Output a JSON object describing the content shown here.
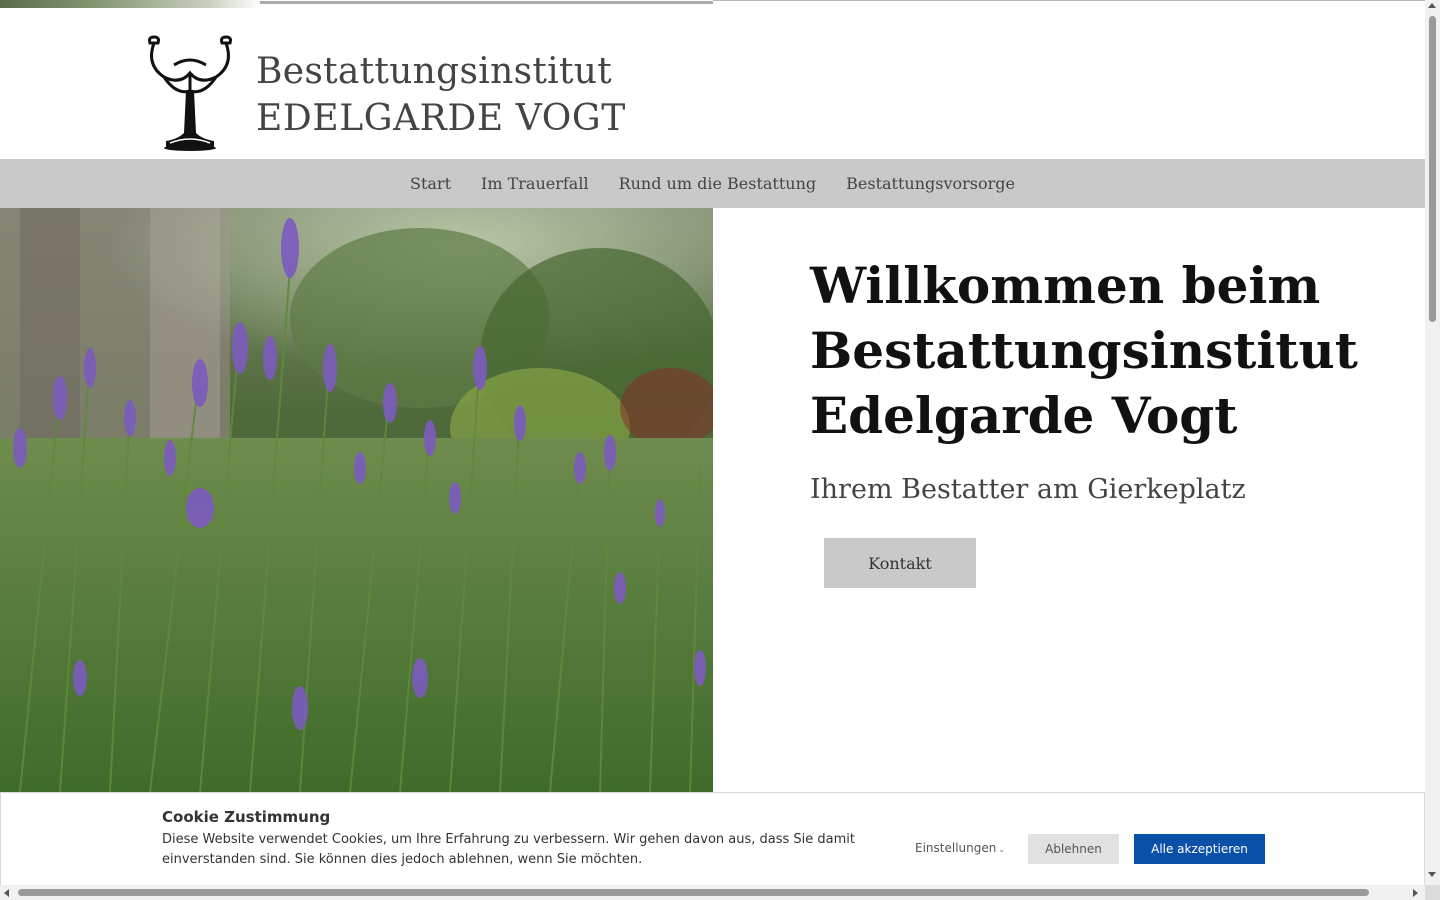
{
  "header": {
    "brand_line1": "Bestattungsinstitut",
    "brand_line2": "EDELGARDE VOGT",
    "logo_icon": "candelabra-logo-icon"
  },
  "nav": {
    "items": [
      {
        "label": "Start"
      },
      {
        "label": "Im Trauerfall"
      },
      {
        "label": "Rund um die Bestattung"
      },
      {
        "label": "Bestattungsvorsorge"
      }
    ]
  },
  "hero": {
    "title": "Willkommen beim Bestattungsinstitut Edelgarde Vogt",
    "subtitle": "Ihrem Bestatter am Gierkeplatz",
    "button_label": "Kontakt",
    "image_subject": "lavender-field-photo"
  },
  "cookie": {
    "title": "Cookie Zustimmung",
    "text": "Diese Website verwendet Cookies, um Ihre Erfahrung zu verbessern. Wir gehen davon aus, dass Sie damit einverstanden sind. Sie können dies jedoch ablehnen, wenn Sie möchten.",
    "settings_label": "Einstellungen",
    "reject_label": "Ablehnen",
    "accept_label": "Alle akzeptieren",
    "accept_color": "#0a4fa8"
  },
  "colors": {
    "nav_bg": "#c9c9c9",
    "button_bg": "#c9c9c9",
    "lavender": "#7c5bbf"
  }
}
